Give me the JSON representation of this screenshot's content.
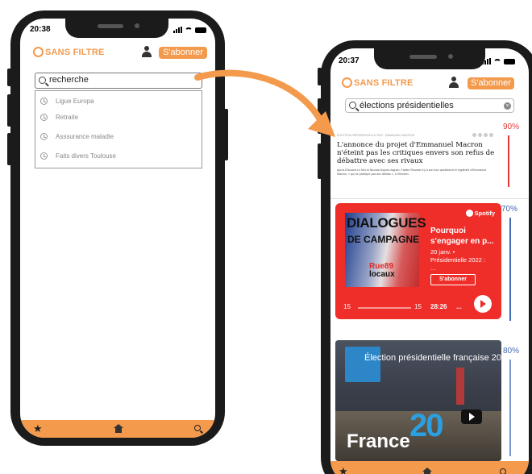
{
  "left_phone": {
    "status": {
      "time": "20:38"
    },
    "header": {
      "logo": "SANS FILTRE",
      "subscribe_label": "S'abonner"
    },
    "search": {
      "value": "recherche"
    },
    "suggestions": [
      {
        "label": "Ligue Europa"
      },
      {
        "label": "Retraite"
      },
      {
        "label": "Asssurance maladie"
      },
      {
        "label": "Faits divers Toulouse"
      }
    ]
  },
  "right_phone": {
    "status": {
      "time": "20:37"
    },
    "header": {
      "logo": "SANS FILTRE",
      "subscribe_label": "S'abonner"
    },
    "search": {
      "value": "élections présidentielles"
    },
    "results": [
      {
        "score": "90%",
        "score_color": "#e53935",
        "type": "article",
        "meta": "ÉLECTION PRÉSIDENTIELLE 2022 · EMMANUEL MACRON",
        "headline": "L'annonce du projet d'Emmanuel Macron n'éteint pas les critiques envers son refus de débattre avec ses rivaux",
        "lede": "Après Édouard Le Moi et Nicolas Dupont-Aignan, Fabien Roussel s'y a son tour questionné le légitimité d'Emmanuel Macron, « qui ne participe pas aux débats », à l'élection."
      },
      {
        "score": "70%",
        "score_color": "#3f6ab3",
        "type": "podcast",
        "cover_line1": "DIALOGUES",
        "cover_line2": "DE CAMPAGNE",
        "cover_brand": "Rue89",
        "cover_brand_sub": "locaux",
        "provider": "Spotify",
        "title": "Pourquoi\ns'engager en p...",
        "meta": "20 janv. •\nPrésidentielle 2022 :\n...",
        "subscribe_label": "S'abonner",
        "rewind": "15",
        "forward": "15",
        "duration": "28:26",
        "more": "..."
      },
      {
        "score": "80%",
        "score_color": "#3f6ab3",
        "type": "video",
        "title": "Élection présidentielle française 20",
        "overlay_number": "20",
        "overlay_word": "France"
      }
    ]
  },
  "colors": {
    "accent": "#f39a4d",
    "podcast_red": "#ef2e2a"
  },
  "icons": {
    "bottom_bar": [
      "star-icon",
      "home-icon",
      "search-icon"
    ]
  }
}
